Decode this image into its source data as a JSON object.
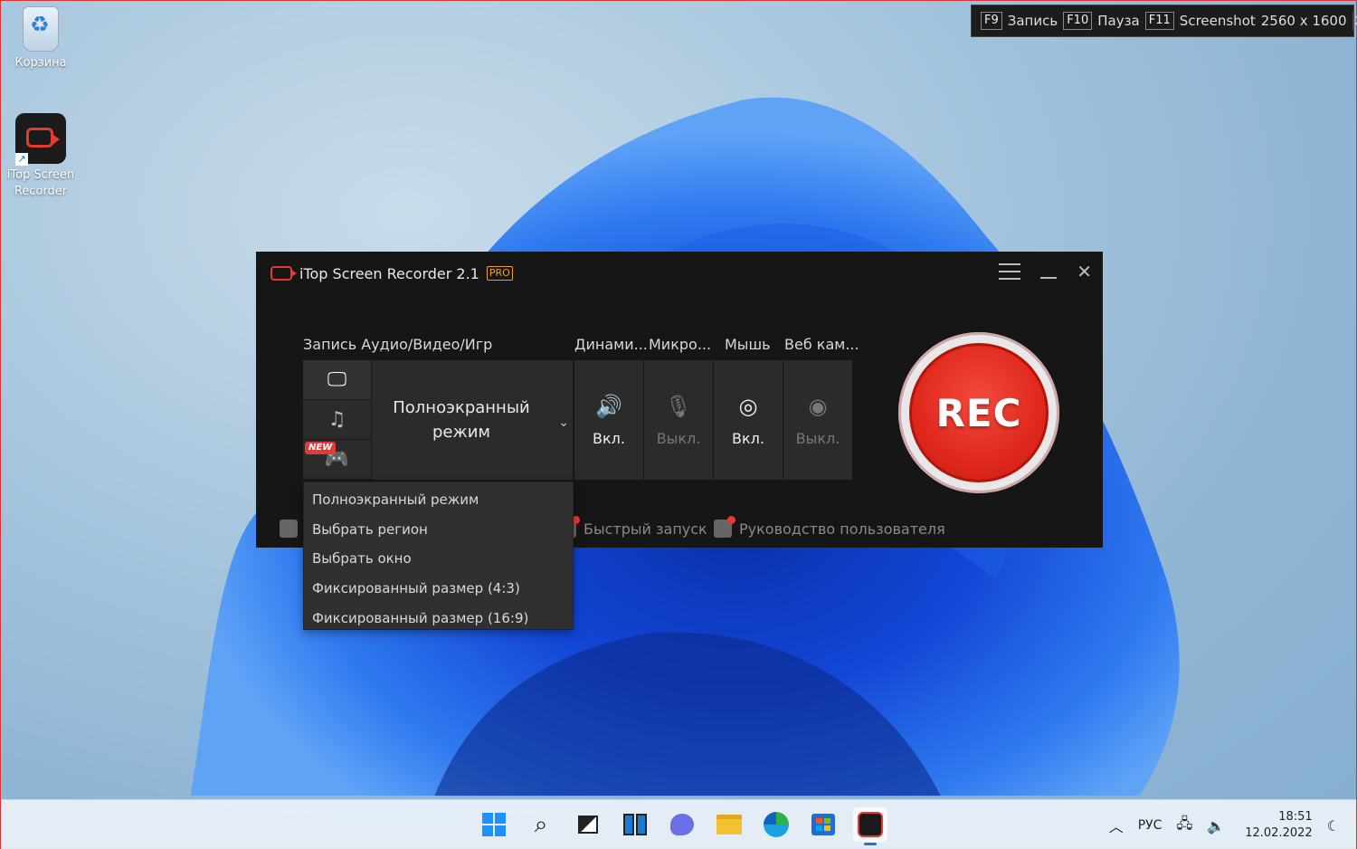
{
  "desktop": {
    "icons": [
      {
        "label": "Корзина"
      },
      {
        "label": "iTop Screen Recorder"
      }
    ]
  },
  "hotkeys": {
    "record_key": "F9",
    "record_label": "Запись",
    "pause_key": "F10",
    "pause_label": "Пауза",
    "shot_key": "F11",
    "shot_label": "Screenshot",
    "resolution": "2560 x 1600"
  },
  "app": {
    "title": "iTop Screen Recorder 2.1",
    "badge": "PRO",
    "section_label": "Запись Аудио/Видео/Игр",
    "mode_label": "Полноэкранный режим",
    "new_tag": "NEW",
    "toggles": [
      {
        "header": "Динами...",
        "state": "Вкл.",
        "icon": "speaker-icon",
        "on": true
      },
      {
        "header": "Микро...",
        "state": "Выкл.",
        "icon": "microphone-icon",
        "on": false
      },
      {
        "header": "Мышь",
        "state": "Вкл.",
        "icon": "mouse-click-icon",
        "on": true
      },
      {
        "header": "Веб кам...",
        "state": "Выкл.",
        "icon": "webcam-icon",
        "on": false
      }
    ],
    "rec_label": "REC",
    "bottom_links": {
      "quick_start": "Быстрый запуск",
      "user_guide": "Руководство пользователя"
    },
    "accent_color": "#e53935"
  },
  "dropdown": {
    "items": [
      "Полноэкранный режим",
      "Выбрать регион",
      "Выбрать окно",
      "Фиксированный размер (4:3)",
      "Фиксированный размер (16:9)"
    ]
  },
  "taskbar": {
    "language": "РУС",
    "time": "18:51",
    "date": "12.02.2022"
  }
}
